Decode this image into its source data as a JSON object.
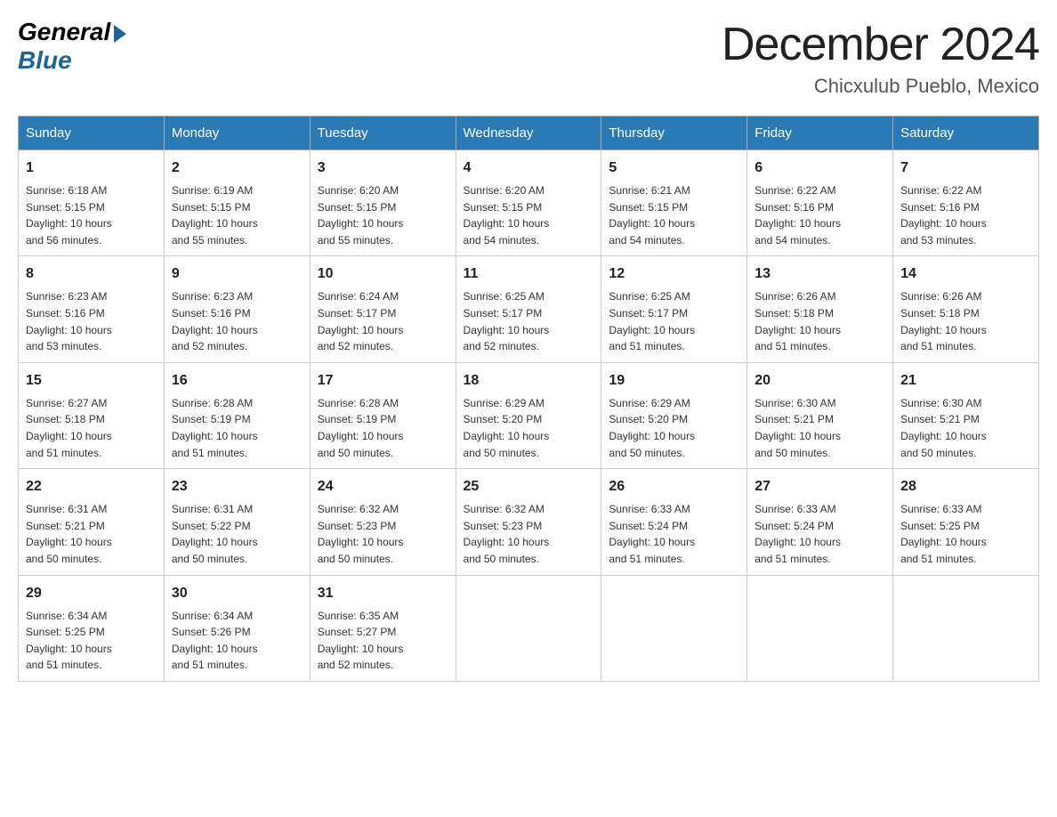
{
  "logo": {
    "general": "General",
    "blue": "Blue"
  },
  "title": "December 2024",
  "location": "Chicxulub Pueblo, Mexico",
  "days_header": [
    "Sunday",
    "Monday",
    "Tuesday",
    "Wednesday",
    "Thursday",
    "Friday",
    "Saturday"
  ],
  "weeks": [
    [
      {
        "day": "1",
        "sunrise": "6:18 AM",
        "sunset": "5:15 PM",
        "daylight": "10 hours and 56 minutes."
      },
      {
        "day": "2",
        "sunrise": "6:19 AM",
        "sunset": "5:15 PM",
        "daylight": "10 hours and 55 minutes."
      },
      {
        "day": "3",
        "sunrise": "6:20 AM",
        "sunset": "5:15 PM",
        "daylight": "10 hours and 55 minutes."
      },
      {
        "day": "4",
        "sunrise": "6:20 AM",
        "sunset": "5:15 PM",
        "daylight": "10 hours and 54 minutes."
      },
      {
        "day": "5",
        "sunrise": "6:21 AM",
        "sunset": "5:15 PM",
        "daylight": "10 hours and 54 minutes."
      },
      {
        "day": "6",
        "sunrise": "6:22 AM",
        "sunset": "5:16 PM",
        "daylight": "10 hours and 54 minutes."
      },
      {
        "day": "7",
        "sunrise": "6:22 AM",
        "sunset": "5:16 PM",
        "daylight": "10 hours and 53 minutes."
      }
    ],
    [
      {
        "day": "8",
        "sunrise": "6:23 AM",
        "sunset": "5:16 PM",
        "daylight": "10 hours and 53 minutes."
      },
      {
        "day": "9",
        "sunrise": "6:23 AM",
        "sunset": "5:16 PM",
        "daylight": "10 hours and 52 minutes."
      },
      {
        "day": "10",
        "sunrise": "6:24 AM",
        "sunset": "5:17 PM",
        "daylight": "10 hours and 52 minutes."
      },
      {
        "day": "11",
        "sunrise": "6:25 AM",
        "sunset": "5:17 PM",
        "daylight": "10 hours and 52 minutes."
      },
      {
        "day": "12",
        "sunrise": "6:25 AM",
        "sunset": "5:17 PM",
        "daylight": "10 hours and 51 minutes."
      },
      {
        "day": "13",
        "sunrise": "6:26 AM",
        "sunset": "5:18 PM",
        "daylight": "10 hours and 51 minutes."
      },
      {
        "day": "14",
        "sunrise": "6:26 AM",
        "sunset": "5:18 PM",
        "daylight": "10 hours and 51 minutes."
      }
    ],
    [
      {
        "day": "15",
        "sunrise": "6:27 AM",
        "sunset": "5:18 PM",
        "daylight": "10 hours and 51 minutes."
      },
      {
        "day": "16",
        "sunrise": "6:28 AM",
        "sunset": "5:19 PM",
        "daylight": "10 hours and 51 minutes."
      },
      {
        "day": "17",
        "sunrise": "6:28 AM",
        "sunset": "5:19 PM",
        "daylight": "10 hours and 50 minutes."
      },
      {
        "day": "18",
        "sunrise": "6:29 AM",
        "sunset": "5:20 PM",
        "daylight": "10 hours and 50 minutes."
      },
      {
        "day": "19",
        "sunrise": "6:29 AM",
        "sunset": "5:20 PM",
        "daylight": "10 hours and 50 minutes."
      },
      {
        "day": "20",
        "sunrise": "6:30 AM",
        "sunset": "5:21 PM",
        "daylight": "10 hours and 50 minutes."
      },
      {
        "day": "21",
        "sunrise": "6:30 AM",
        "sunset": "5:21 PM",
        "daylight": "10 hours and 50 minutes."
      }
    ],
    [
      {
        "day": "22",
        "sunrise": "6:31 AM",
        "sunset": "5:21 PM",
        "daylight": "10 hours and 50 minutes."
      },
      {
        "day": "23",
        "sunrise": "6:31 AM",
        "sunset": "5:22 PM",
        "daylight": "10 hours and 50 minutes."
      },
      {
        "day": "24",
        "sunrise": "6:32 AM",
        "sunset": "5:23 PM",
        "daylight": "10 hours and 50 minutes."
      },
      {
        "day": "25",
        "sunrise": "6:32 AM",
        "sunset": "5:23 PM",
        "daylight": "10 hours and 50 minutes."
      },
      {
        "day": "26",
        "sunrise": "6:33 AM",
        "sunset": "5:24 PM",
        "daylight": "10 hours and 51 minutes."
      },
      {
        "day": "27",
        "sunrise": "6:33 AM",
        "sunset": "5:24 PM",
        "daylight": "10 hours and 51 minutes."
      },
      {
        "day": "28",
        "sunrise": "6:33 AM",
        "sunset": "5:25 PM",
        "daylight": "10 hours and 51 minutes."
      }
    ],
    [
      {
        "day": "29",
        "sunrise": "6:34 AM",
        "sunset": "5:25 PM",
        "daylight": "10 hours and 51 minutes."
      },
      {
        "day": "30",
        "sunrise": "6:34 AM",
        "sunset": "5:26 PM",
        "daylight": "10 hours and 51 minutes."
      },
      {
        "day": "31",
        "sunrise": "6:35 AM",
        "sunset": "5:27 PM",
        "daylight": "10 hours and 52 minutes."
      },
      null,
      null,
      null,
      null
    ]
  ],
  "labels": {
    "sunrise": "Sunrise:",
    "sunset": "Sunset:",
    "daylight": "Daylight:"
  }
}
